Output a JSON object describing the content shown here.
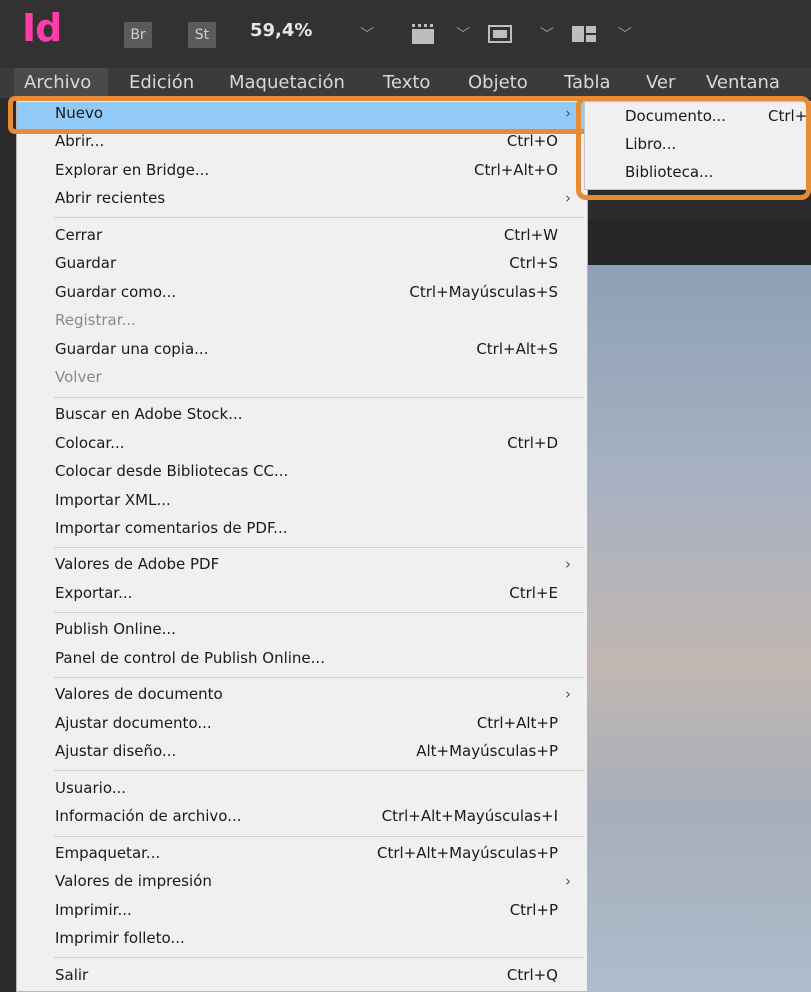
{
  "app": {
    "logo": "Id",
    "bridge_label": "Br",
    "stock_label": "St",
    "zoom": "59,4%"
  },
  "menubar": [
    "Archivo",
    "Edición",
    "Maquetación",
    "Texto",
    "Objeto",
    "Tabla",
    "Ver",
    "Ventana"
  ],
  "menu": {
    "items": [
      {
        "label": "Nuevo",
        "shortcut": "",
        "submenu": true
      },
      {
        "label": "Abrir...",
        "shortcut": "Ctrl+O"
      },
      {
        "label": "Explorar en Bridge...",
        "shortcut": "Ctrl+Alt+O"
      },
      {
        "label": "Abrir recientes",
        "shortcut": "",
        "submenu": true
      },
      {
        "label": "Cerrar",
        "shortcut": "Ctrl+W"
      },
      {
        "label": "Guardar",
        "shortcut": "Ctrl+S"
      },
      {
        "label": "Guardar como...",
        "shortcut": "Ctrl+Mayúsculas+S"
      },
      {
        "label": "Registrar...",
        "shortcut": "",
        "disabled": true
      },
      {
        "label": "Guardar una copia...",
        "shortcut": "Ctrl+Alt+S"
      },
      {
        "label": "Volver",
        "shortcut": "",
        "disabled": true
      },
      {
        "label": "Buscar en Adobe Stock...",
        "shortcut": ""
      },
      {
        "label": "Colocar...",
        "shortcut": "Ctrl+D"
      },
      {
        "label": "Colocar desde Bibliotecas CC...",
        "shortcut": ""
      },
      {
        "label": "Importar XML...",
        "shortcut": ""
      },
      {
        "label": "Importar comentarios de PDF...",
        "shortcut": ""
      },
      {
        "label": "Valores de Adobe PDF",
        "shortcut": "",
        "submenu": true
      },
      {
        "label": "Exportar...",
        "shortcut": "Ctrl+E"
      },
      {
        "label": "Publish Online...",
        "shortcut": ""
      },
      {
        "label": "Panel de control de Publish Online...",
        "shortcut": ""
      },
      {
        "label": "Valores de documento",
        "shortcut": "",
        "submenu": true
      },
      {
        "label": "Ajustar documento...",
        "shortcut": "Ctrl+Alt+P"
      },
      {
        "label": "Ajustar diseño...",
        "shortcut": "Alt+Mayúsculas+P"
      },
      {
        "label": "Usuario...",
        "shortcut": ""
      },
      {
        "label": "Información de archivo...",
        "shortcut": "Ctrl+Alt+Mayúsculas+I"
      },
      {
        "label": "Empaquetar...",
        "shortcut": "Ctrl+Alt+Mayúsculas+P"
      },
      {
        "label": "Valores de impresión",
        "shortcut": "",
        "submenu": true
      },
      {
        "label": "Imprimir...",
        "shortcut": "Ctrl+P"
      },
      {
        "label": "Imprimir folleto...",
        "shortcut": ""
      },
      {
        "label": "Salir",
        "shortcut": "Ctrl+Q"
      }
    ],
    "submenu_arrow": "›"
  },
  "submenu": {
    "items": [
      {
        "label": "Documento...",
        "shortcut": "Ctrl+"
      },
      {
        "label": "Libro...",
        "shortcut": ""
      },
      {
        "label": "Biblioteca...",
        "shortcut": ""
      }
    ]
  },
  "colors": {
    "highlight": "#91c9f7",
    "callout": "#e98a34",
    "logo": "#ff3ca7"
  }
}
